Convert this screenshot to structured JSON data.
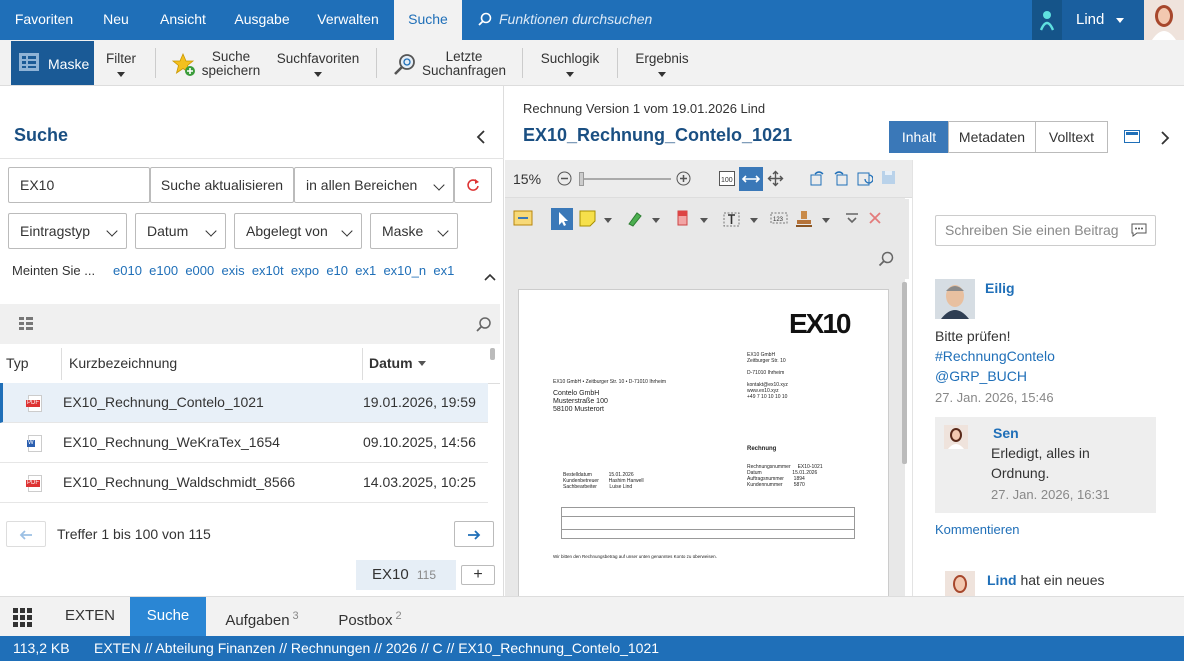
{
  "top_nav": {
    "tabs": [
      "Favoriten",
      "Neu",
      "Ansicht",
      "Ausgabe",
      "Verwalten",
      "Suche"
    ],
    "active_tab": "Suche",
    "search_placeholder": "Funktionen durchsuchen",
    "user_name": "Lind"
  },
  "ribbon": {
    "mask": "Maske",
    "filter": "Filter",
    "save_search_1": "Suche",
    "save_search_2": "speichern",
    "favorites": "Suchfavoriten",
    "last_1": "Letzte",
    "last_2": "Suchanfragen",
    "logic": "Suchlogik",
    "result": "Ergebnis"
  },
  "search_panel": {
    "title": "Suche",
    "query": "EX10",
    "update_button": "Suche aktualisieren",
    "scope": "in allen Bereichen",
    "filters": [
      "Eintragstyp",
      "Datum",
      "Abgelegt von",
      "Maske"
    ],
    "did_you_mean": "Meinten Sie ...",
    "suggestions": [
      "e010",
      "e100",
      "e000",
      "exis",
      "ex10t",
      "expo",
      "e10",
      "ex1",
      "ex10_n",
      "ex1"
    ],
    "columns": {
      "type": "Typ",
      "name": "Kurzbezeichnung",
      "date": "Datum"
    },
    "rows": [
      {
        "icon": "PDF",
        "name": "EX10_Rechnung_Contelo_1021",
        "date": "19.01.2026, 19:59"
      },
      {
        "icon": "W",
        "name": "EX10_Rechnung_WeKraTex_1654",
        "date": "09.10.2025, 14:56"
      },
      {
        "icon": "PDF",
        "name": "EX10_Rechnung_Waldschmidt_8566",
        "date": "14.03.2025, 10:25"
      }
    ],
    "paging": "Treffer 1 bis 100 von 115",
    "saved_tag": "EX10",
    "saved_count": "115"
  },
  "document": {
    "meta": "Rechnung  Version 1 vom 19.01.2026  Lind",
    "title": "EX10_Rechnung_Contelo_1021",
    "view_tabs": [
      "Inhalt",
      "Metadaten",
      "Volltext"
    ],
    "active_view": "Inhalt",
    "zoom": "15%",
    "preview": {
      "logo": "EX10",
      "sender_line": "EX10 GmbH • Zeitburger Str. 10 • D-71010 Ihrheim",
      "address": [
        "Contelo GmbH",
        "Musterstraße 100",
        "58100 Musterort"
      ],
      "heading": "Rechnung",
      "footer": "Wir bitten den Rechnungsbetrag auf unser unten genanntes Konto zu überweisen."
    }
  },
  "comments": {
    "placeholder": "Schreiben Sie einen Beitrag",
    "entries": [
      {
        "author": "Eilig",
        "text_1": "Bitte prüfen!",
        "tag_1": "#RechnungContelo",
        "tag_2": "@GRP_BUCH",
        "time": "27. Jan. 2026, 15:46"
      },
      {
        "author": "Sen",
        "text_1": "Erledigt, alles in",
        "text_2": "Ordnung.",
        "time": "27. Jan. 2026, 16:31"
      }
    ],
    "reply": "Kommentieren",
    "last_author": "Lind",
    "last_text": "hat ein neues"
  },
  "bottom_tabs": {
    "items": [
      "EXTEN",
      "Suche",
      "Aufgaben",
      "Postbox"
    ],
    "active": "Suche",
    "aufgaben_badge": "3",
    "postbox_badge": "2"
  },
  "status": {
    "size": "113,2 KB",
    "path": "EXTEN // Abteilung Finanzen // Rechnungen // 2026 // C // EX10_Rechnung_Contelo_1021"
  }
}
